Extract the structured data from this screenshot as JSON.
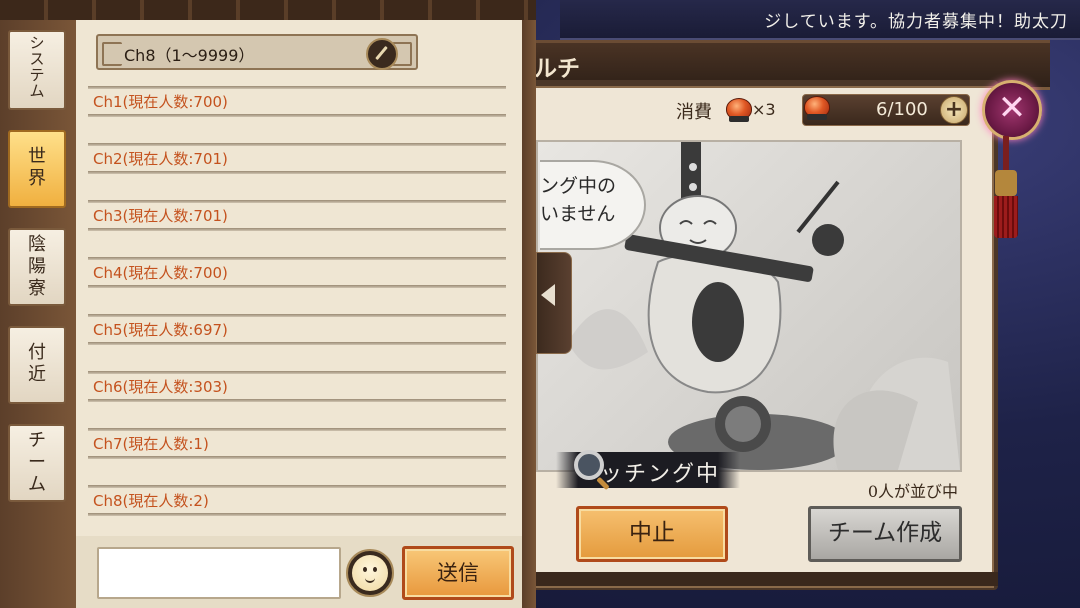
{
  "ticker": {
    "text": "ジしています。協力者募集中！助太刀"
  },
  "title": {
    "text": "ルチ"
  },
  "cost": {
    "label": "消費",
    "multiplier": "×3"
  },
  "stock": {
    "value": "6/100",
    "plus": "+"
  },
  "close": {
    "icon": "close-icon"
  },
  "speech": {
    "text": "ング中の\nいません"
  },
  "matching": {
    "text": "ッチング中"
  },
  "queue": {
    "text": "0人が並び中"
  },
  "buttons": {
    "cancel": "中止",
    "create_team": "チーム作成",
    "send": "送信"
  },
  "tabs": [
    {
      "label": "システム",
      "active": false
    },
    {
      "label": "世界",
      "active": true
    },
    {
      "label": "陰陽寮",
      "active": false
    },
    {
      "label": "付近",
      "active": false
    },
    {
      "label": "チーム",
      "active": false
    }
  ],
  "channel_selector": {
    "text": "Ch8（1〜9999）"
  },
  "channels": [
    "Ch1(現在人数:700)",
    "Ch2(現在人数:701)",
    "Ch3(現在人数:701)",
    "Ch4(現在人数:700)",
    "Ch5(現在人数:697)",
    "Ch6(現在人数:303)",
    "Ch7(現在人数:1)",
    "Ch8(現在人数:2)"
  ],
  "chat_input": {
    "value": "",
    "placeholder": ""
  },
  "colors": {
    "accent_orange": "#e8983c",
    "channel_text": "#c4521e",
    "close_magenta": "#a0366e"
  }
}
